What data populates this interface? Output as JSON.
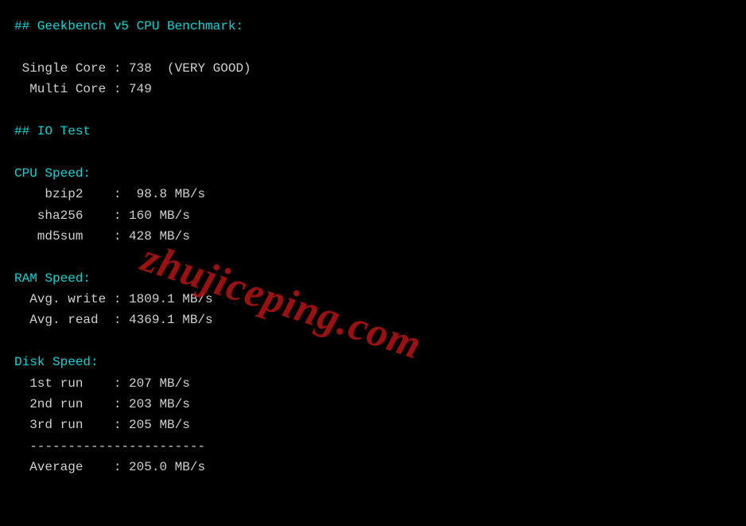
{
  "geekbench": {
    "header": "## Geekbench v5 CPU Benchmark:",
    "single_core_label": " Single Core",
    "single_core_value": "738  (VERY GOOD)",
    "multi_core_label": "  Multi Core",
    "multi_core_value": "749"
  },
  "io_test": {
    "header": "## IO Test"
  },
  "cpu_speed": {
    "header": "CPU Speed:",
    "rows": [
      {
        "label": "    bzip2    ",
        "value": " 98.8 MB/s"
      },
      {
        "label": "   sha256    ",
        "value": "160 MB/s"
      },
      {
        "label": "   md5sum    ",
        "value": "428 MB/s"
      }
    ]
  },
  "ram_speed": {
    "header": "RAM Speed:",
    "rows": [
      {
        "label": "  Avg. write ",
        "value": "1809.1 MB/s"
      },
      {
        "label": "  Avg. read  ",
        "value": "4369.1 MB/s"
      }
    ]
  },
  "disk_speed": {
    "header": "Disk Speed:",
    "rows": [
      {
        "label": "  1st run    ",
        "value": "207 MB/s"
      },
      {
        "label": "  2nd run    ",
        "value": "203 MB/s"
      },
      {
        "label": "  3rd run    ",
        "value": "205 MB/s"
      }
    ],
    "separator": "  -----------------------",
    "avg_label": "  Average    ",
    "avg_value": "205.0 MB/s"
  },
  "watermark": "zhujiceping.com"
}
